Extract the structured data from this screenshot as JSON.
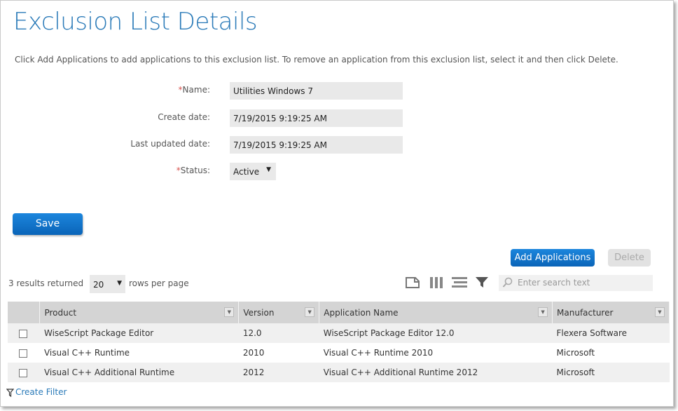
{
  "page": {
    "title": "Exclusion List Details",
    "intro": "Click Add Applications to add applications to this exclusion list. To remove an application from this exclusion list, select it and then click Delete."
  },
  "form": {
    "name_label": "Name:",
    "name_value": "Utilities Windows 7",
    "create_date_label": "Create date:",
    "create_date_value": "7/19/2015 9:19:25 AM",
    "updated_date_label": "Last updated date:",
    "updated_date_value": "7/19/2015 9:19:25 AM",
    "status_label": "Status:",
    "status_value": "Active",
    "required_marker": "*"
  },
  "buttons": {
    "save": "Save",
    "add_applications": "Add Applications",
    "delete": "Delete"
  },
  "grid": {
    "results_text": "3 results returned",
    "rows_per_page_value": "20",
    "rows_per_page_label": "rows per page",
    "search_placeholder": "Enter search text",
    "columns": [
      "Product",
      "Version",
      "Application Name",
      "Manufacturer"
    ],
    "rows": [
      {
        "product": "WiseScript Package Editor",
        "version": "12.0",
        "application_name": "WiseScript Package Editor 12.0",
        "manufacturer": "Flexera Software"
      },
      {
        "product": "Visual C++ Runtime",
        "version": "2010",
        "application_name": "Visual C++ Runtime 2010",
        "manufacturer": "Microsoft"
      },
      {
        "product": "Visual C++ Additional Runtime",
        "version": "2012",
        "application_name": "Visual C++ Additional Runtime 2012",
        "manufacturer": "Microsoft"
      }
    ],
    "create_filter": "Create Filter"
  },
  "icons": {
    "export": "export-icon",
    "columns": "columns-icon",
    "grouping": "grouping-icon",
    "filter": "filter-icon",
    "search": "search-icon",
    "caret": "▼"
  },
  "colors": {
    "accent": "#2a7ab8",
    "button": "#0a64b8",
    "required": "#d9534f"
  }
}
